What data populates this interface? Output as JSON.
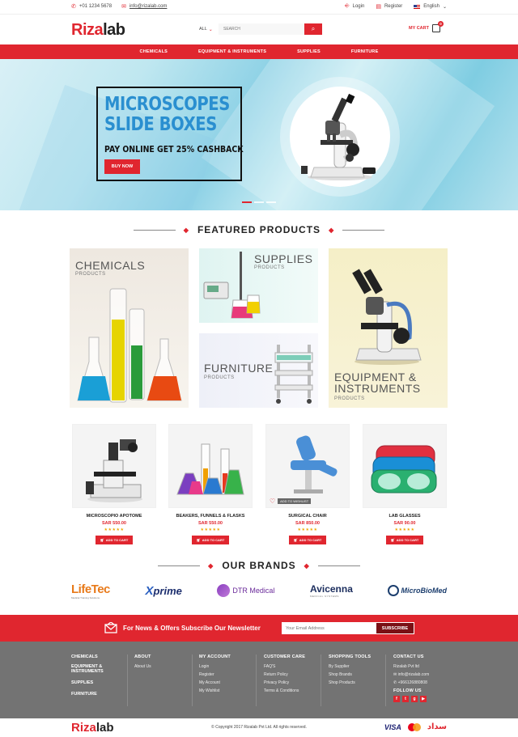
{
  "topbar": {
    "phone": "+01 1234 5678",
    "email": "info@rizalab.com",
    "login": "Login",
    "register": "Register",
    "language": "English"
  },
  "header": {
    "logo_part1": "Riza",
    "logo_part2": "lab",
    "search_category": "ALL",
    "search_placeholder": "SEARCH",
    "cart_label": "MY CART",
    "cart_count": "0"
  },
  "nav": [
    "CHEMICALS",
    "EQUIPMENT & INSTRUMENTS",
    "SUPPLIES",
    "FURNITURE"
  ],
  "hero": {
    "title_line1": "MICROSCOPES",
    "title_line2": "SLIDE BOXES",
    "tagline": "PAY ONLINE GET 25% CASHBACK",
    "button": "BUY NOW"
  },
  "featured": {
    "title": "FEATURED PRODUCTS",
    "tiles": [
      {
        "title": "CHEMICALS",
        "sub": "PRODUCTS"
      },
      {
        "title": "SUPPLIES",
        "sub": "PRODUCTS"
      },
      {
        "title": "FURNITURE",
        "sub": "PRODUCTS"
      },
      {
        "title_line1": "EQUIPMENT &",
        "title_line2": "INSTRUMENTS",
        "sub": "PRODUCTS"
      }
    ]
  },
  "products": [
    {
      "name": "MICROSCOPIO APOTOME",
      "price": "SAR 550.00",
      "stars": "★★★★★",
      "button": "ADD TO CART"
    },
    {
      "name": "BEAKERS, FUNNELS & FLASKS",
      "price": "SAR 550.00",
      "stars": "★★★★★",
      "button": "ADD TO CART"
    },
    {
      "name": "SURGICAL CHAIR",
      "price": "SAR 850.00",
      "stars": "★★★★★",
      "button": "ADD TO CART",
      "wishlist": "ADD TO WISHLIST"
    },
    {
      "name": "LAB GLASSES",
      "price": "SAR 90.00",
      "stars": "★★★★★",
      "button": "ADD TO CART"
    }
  ],
  "brands": {
    "title": "OUR BRANDS",
    "lifetec_main": "LifeTec",
    "lifetec_sub": "Medical Training Solutions",
    "xprime": "prime",
    "dtr": "DTR Medical",
    "avicenna": "Avicenna",
    "avicenna_sub": "MEDICAL SYSTEMS",
    "microbiomed": "MicroBioMed"
  },
  "newsletter": {
    "text": "For News & Offers Subscribe Our Newsletter",
    "placeholder": "Your Email Address",
    "button": "SUBSCRIBE"
  },
  "footer": {
    "col1": {
      "items": [
        "CHEMICALS",
        "EQUIPMENT &",
        "INSTRUMENTS",
        "SUPPLIES",
        "FURNITURE"
      ]
    },
    "about": {
      "heading": "ABOUT",
      "items": [
        "About Us"
      ]
    },
    "account": {
      "heading": "MY ACCOUNT",
      "items": [
        "Login",
        "Register",
        "My Account",
        "My Wishlist"
      ]
    },
    "care": {
      "heading": "CUSTOMER CARE",
      "items": [
        "FAQ'S",
        "Return Policy",
        "Privacy Policy",
        "Terms & Conditions"
      ]
    },
    "tools": {
      "heading": "SHOPPING TOOLS",
      "items": [
        "By Supplier",
        "Shop Brands",
        "Shop Products"
      ]
    },
    "contact": {
      "heading": "CONTACT US",
      "company": "Rizalab Pvt ltd",
      "email": "info@rizalab.com",
      "phone": "+966126880808",
      "follow": "FOLLOW US"
    }
  },
  "bottom": {
    "copyright": "© Copyright 2017 Rizalab Pvt Ltd. All rights reserved.",
    "visa": "VISA",
    "sadad": "سداد"
  }
}
